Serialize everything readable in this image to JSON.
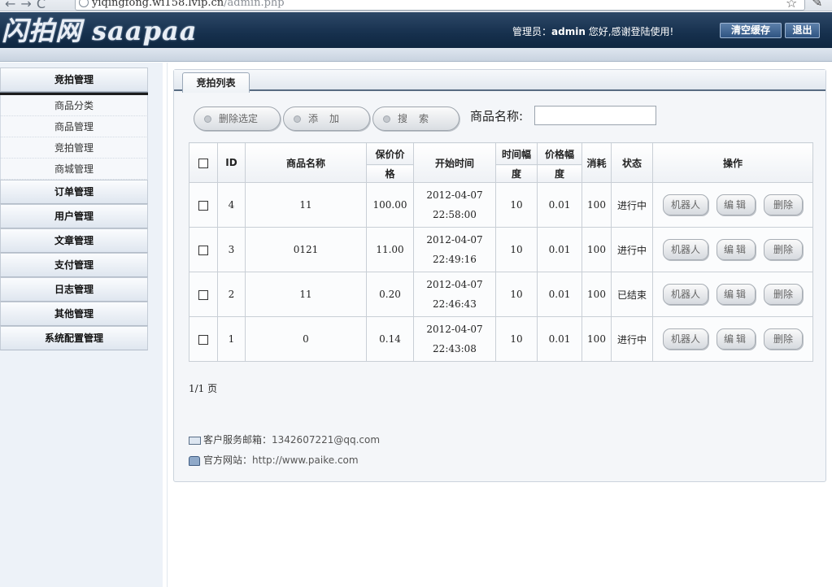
{
  "browser": {
    "url_main": "yiqingfong.wi158.lvip.cn",
    "url_path": "/admin.php"
  },
  "header": {
    "logo": "闪拍网 saapaa",
    "greeting_prefix": "管理员：",
    "admin_user": "admin",
    "greeting_suffix": " 您好,感谢登陆使用!",
    "clear_cache": "清空缓存",
    "logout": "退出"
  },
  "sidebar": {
    "groups": [
      {
        "label": "竞拍管理",
        "subitems": [
          "商品分类",
          "商品管理",
          "竞拍管理",
          "商城管理"
        ]
      },
      {
        "label": "订单管理"
      },
      {
        "label": "用户管理"
      },
      {
        "label": "文章管理"
      },
      {
        "label": "支付管理"
      },
      {
        "label": "日志管理"
      },
      {
        "label": "其他管理"
      },
      {
        "label": "系统配置管理"
      }
    ]
  },
  "main": {
    "tab": "竞拍列表",
    "toolbar": {
      "delete_selected": "删除选定",
      "add": "添加",
      "search": "搜索",
      "search_label": "商品名称:",
      "search_value": ""
    },
    "table": {
      "columns": [
        "ID",
        "商品名称",
        "保价价格",
        "开始时间",
        "时间幅度",
        "价格幅度",
        "消耗",
        "状态",
        "操作"
      ],
      "col_price": [
        "保价价",
        "格"
      ],
      "col_time_step": [
        "时间幅",
        "度"
      ],
      "col_price_step": [
        "价格幅",
        "度"
      ],
      "rows": [
        {
          "id": "4",
          "name": "11",
          "price": "100.00",
          "date": "2012-04-07",
          "time": "22:58:00",
          "time_step": "10",
          "price_step": "0.01",
          "cost": "100",
          "status": "进行中"
        },
        {
          "id": "3",
          "name": "0121",
          "price": "11.00",
          "date": "2012-04-07",
          "time": "22:49:16",
          "time_step": "10",
          "price_step": "0.01",
          "cost": "100",
          "status": "进行中"
        },
        {
          "id": "2",
          "name": "11",
          "price": "0.20",
          "date": "2012-04-07",
          "time": "22:46:43",
          "time_step": "10",
          "price_step": "0.01",
          "cost": "100",
          "status": "已结束"
        },
        {
          "id": "1",
          "name": "0",
          "price": "0.14",
          "date": "2012-04-07",
          "time": "22:43:08",
          "time_step": "10",
          "price_step": "0.01",
          "cost": "100",
          "status": "进行中"
        }
      ],
      "row_actions": {
        "robot": "机器人",
        "edit": "编辑",
        "delete": "删除"
      }
    },
    "pager": "1/1 页",
    "footer": {
      "email_label": "客户服务邮箱：",
      "email": "1342607221@qq.com",
      "site_label": "官方网站：",
      "site": "http://www.paike.com"
    }
  },
  "colors": {
    "header_bg": "#16304d",
    "header_button": "#2f5482",
    "sidebar_bg": "#edf2f8",
    "panel_bg": "#f4f6f9"
  }
}
